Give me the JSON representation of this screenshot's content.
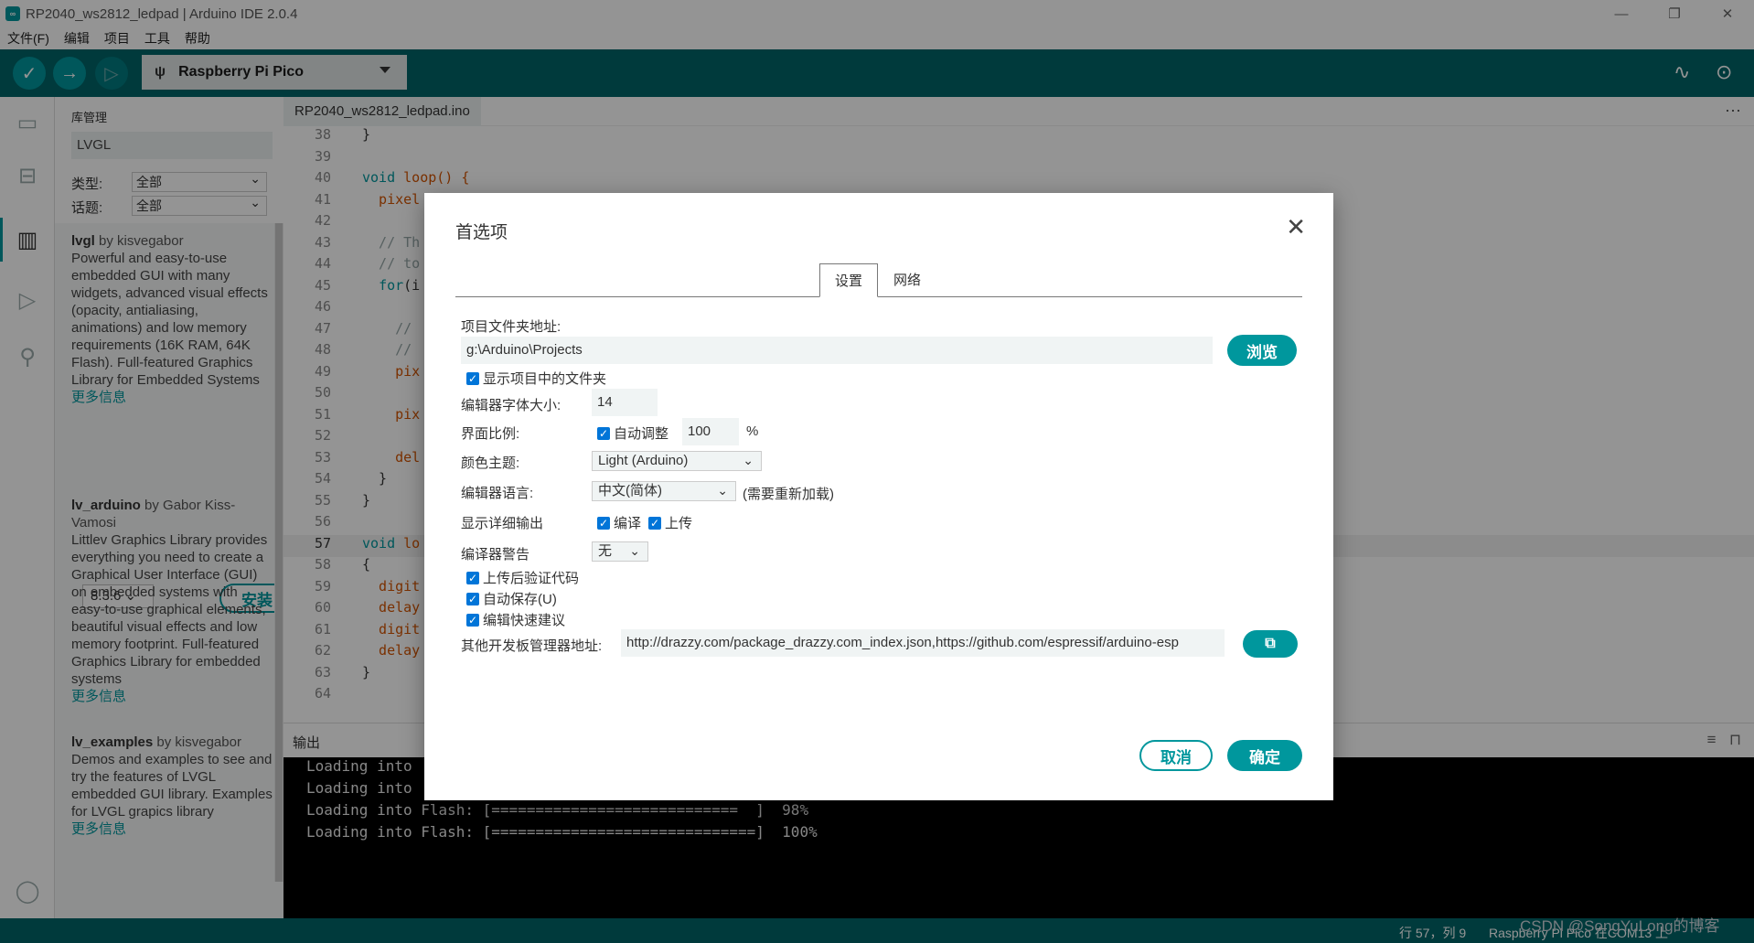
{
  "window": {
    "title": "RP2040_ws2812_ledpad | Arduino IDE 2.0.4",
    "controls": [
      "—",
      "❐",
      "✕"
    ]
  },
  "menu": [
    "文件(F)",
    "编辑",
    "项目",
    "工具",
    "帮助"
  ],
  "toolbar": {
    "board": "Raspberry Pi Pico"
  },
  "library": {
    "title": "库管理",
    "search": "LVGL",
    "type_label": "类型:",
    "type_value": "全部",
    "topic_label": "话题:",
    "topic_value": "全部",
    "items": [
      {
        "name": "lvgl",
        "by": " by kisvegabor",
        "desc": "Powerful and easy-to-use embedded GUI with many widgets, advanced visual effects (opacity, antialiasing, animations) and low memory requirements (16K RAM, 64K Flash). Full-featured Graphics Library for Embedded Systems",
        "more": "更多信息",
        "version": "8.3.6",
        "install": "安装"
      },
      {
        "name": "lv_arduino",
        "by": " by Gabor Kiss-Vamosi",
        "desc": "Littlev Graphics Library provides everything you need to create a Graphical User Interface (GUI) on embedded systems with easy-to-use graphical elements, beautiful visual effects and low memory footprint. Full-featured Graphics Library for embedded systems",
        "more": "更多信息"
      },
      {
        "name": "lv_examples",
        "by": " by kisvegabor",
        "desc": "Demos and examples to see and try the features of LVGL embedded GUI library. Examples for LVGL grapics library",
        "more": "更多信息"
      }
    ]
  },
  "editor": {
    "tab": "RP2040_ws2812_ledpad.ino",
    "lines": [
      {
        "n": "38",
        "t": "}"
      },
      {
        "n": "39",
        "t": ""
      },
      {
        "n": "40",
        "t": "void loop() {"
      },
      {
        "n": "41",
        "t": "  pixel"
      },
      {
        "n": "42",
        "t": ""
      },
      {
        "n": "43",
        "t": "  // Th"
      },
      {
        "n": "44",
        "t": "  // to"
      },
      {
        "n": "45",
        "t": "  for(i"
      },
      {
        "n": "46",
        "t": ""
      },
      {
        "n": "47",
        "t": "    //"
      },
      {
        "n": "48",
        "t": "    //"
      },
      {
        "n": "49",
        "t": "    pix"
      },
      {
        "n": "50",
        "t": ""
      },
      {
        "n": "51",
        "t": "    pix"
      },
      {
        "n": "52",
        "t": ""
      },
      {
        "n": "53",
        "t": "    del"
      },
      {
        "n": "54",
        "t": "  }"
      },
      {
        "n": "55",
        "t": "}"
      },
      {
        "n": "56",
        "t": ""
      },
      {
        "n": "57",
        "t": "void lo"
      },
      {
        "n": "58",
        "t": "{"
      },
      {
        "n": "59",
        "t": "  digit"
      },
      {
        "n": "60",
        "t": "  delay"
      },
      {
        "n": "61",
        "t": "  digit"
      },
      {
        "n": "62",
        "t": "  delay"
      },
      {
        "n": "63",
        "t": "}"
      },
      {
        "n": "64",
        "t": ""
      }
    ]
  },
  "output": {
    "title": "输出",
    "lines": [
      "Loading into",
      "Loading into",
      "Loading into Flash: [============================  ]  98%",
      "Loading into Flash: [==============================]  100%"
    ]
  },
  "status": {
    "position": "行 57，列 9",
    "board": "Raspberry Pi Pico 在COM13 上",
    "watermark": "CSDN @SongYuLong的博客"
  },
  "dialog": {
    "title": "首选项",
    "tabs": [
      "设置",
      "网络"
    ],
    "sketchbook_label": "项目文件夹地址:",
    "sketchbook_value": "g:\\Arduino\\Projects",
    "browse": "浏览",
    "show_files": "显示项目中的文件夹",
    "font_size_label": "编辑器字体大小:",
    "font_size_value": "14",
    "scale_label": "界面比例:",
    "scale_auto": "自动调整",
    "scale_value": "100",
    "scale_unit": "%",
    "theme_label": "颜色主题:",
    "theme_value": "Light (Arduino)",
    "language_label": "编辑器语言:",
    "language_value": "中文(简体)",
    "language_note": "(需要重新加载)",
    "verbose_label": "显示详细输出",
    "verbose_compile": "编译",
    "verbose_upload": "上传",
    "warnings_label": "编译器警告",
    "warnings_value": "无",
    "verify_after_upload": "上传后验证代码",
    "auto_save": "自动保存(U)",
    "quick_suggestions": "编辑快速建议",
    "board_urls_label": "其他开发板管理器地址:",
    "board_urls_value": "http://drazzy.com/package_drazzy.com_index.json,https://github.com/espressif/arduino-esp",
    "cancel": "取消",
    "ok": "确定"
  }
}
